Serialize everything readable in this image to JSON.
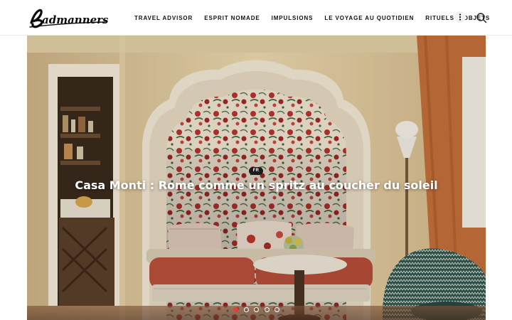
{
  "brand": {
    "logo_text": "Badmanners"
  },
  "nav": {
    "items": [
      {
        "label": "TRAVEL ADVISOR"
      },
      {
        "label": "ESPRIT NOMADE"
      },
      {
        "label": "IMPULSIONS"
      },
      {
        "label": "LE VOYAGE AU QUOTIDIEN"
      },
      {
        "label": "RITUELS & OBJETS"
      }
    ],
    "more_icon": "vertical-ellipsis-icon",
    "search_icon": "search-icon"
  },
  "hero": {
    "badge": "FR",
    "title": "Casa Monti : Rome comme un spritz au coucher du soleil",
    "slides": {
      "total": 5,
      "active": 1
    },
    "colors": {
      "active_dot": "#e0403a",
      "wall": "#e9d3a6",
      "sofa": "#b8513c"
    }
  }
}
